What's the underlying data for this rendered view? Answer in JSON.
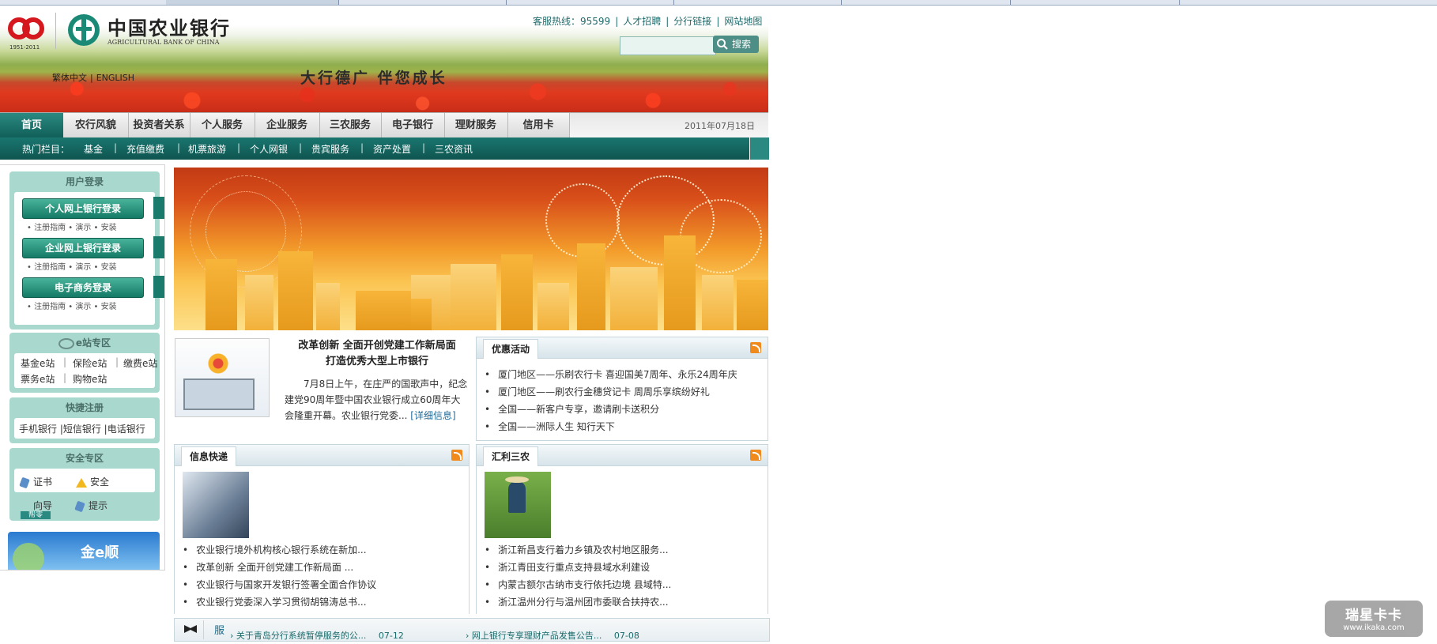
{
  "header": {
    "logo_60_text": "60",
    "logo_60_years": "1951-2011",
    "bank_name_cn": "中国农业银行",
    "bank_name_en": "AGRICULTURAL BANK OF CHINA",
    "slogan": "大行德广  伴您成长",
    "lang_traditional": "繁体中文",
    "lang_english": "ENGLISH",
    "hotline": "客服热线：95599",
    "links": [
      "人才招聘",
      "分行链接",
      "网站地图"
    ],
    "search_placeholder": "",
    "search_label": "搜索"
  },
  "nav": {
    "home": "首页",
    "items": [
      "农行风貌",
      "投资者关系",
      "个人服务",
      "企业服务",
      "三农服务",
      "电子银行",
      "理财服务",
      "信用卡"
    ],
    "date": "2011年07月18日"
  },
  "subnav": {
    "label": "热门栏目：",
    "items": [
      "基金",
      "充值缴费",
      "机票旅游",
      "个人网银",
      "贵宾服务",
      "资产处置",
      "三农资讯"
    ]
  },
  "sidebar": {
    "login_title": "用户登录",
    "personal_login": "个人网上银行登录",
    "corporate_login": "企业网上银行登录",
    "ecommerce_login": "电子商务登录",
    "login_sublinks": "• 注册指南 • 演示 • 安装",
    "estation_title": "e站专区",
    "estation_row1": [
      "基金e站",
      "保险e站",
      "缴费e站"
    ],
    "estation_row2": [
      "票务e站",
      "购物e站"
    ],
    "quick_title": "快捷注册",
    "quick_items": "手机银行 |短信银行 |电话银行",
    "security_title": "安全专区",
    "security_items": [
      "证书",
      "安全",
      "向导",
      "提示"
    ],
    "security_badge": "帮零",
    "promo_text": "金e顺",
    "promo_badge": "金e顺"
  },
  "news": {
    "title_line1": "改革创新  全面开创党建工作新局面",
    "title_line2": "打造优秀大型上市银行",
    "body": "7月8日上午，在庄严的国歌声中，纪念建党90周年暨中国农业银行成立60周年大会隆重开幕。农业银行党委...",
    "more": "[详细信息]"
  },
  "promo_box": {
    "title": "优惠活动",
    "items": [
      "厦门地区——乐刷农行卡  喜迎国美7周年、永乐24周年庆",
      "厦门地区——刷农行金穗贷记卡  周周乐享缤纷好礼",
      "全国——新客户专享，邀请刷卡送积分",
      "全国——洲际人生  知行天下"
    ]
  },
  "info_box": {
    "title": "信息快递",
    "items": [
      "农业银行境外机构核心银行系统在新加...",
      "改革创新  全面开创党建工作新局面  ...",
      "农业银行与国家开发银行签署全面合作协议",
      "农业银行党委深入学习贯彻胡锦涛总书..."
    ]
  },
  "farm_box": {
    "title": "汇利三农",
    "items": [
      "浙江新昌支行着力乡镇及农村地区服务...",
      "浙江青田支行重点支持县域水利建设",
      "内蒙古额尔古纳市支行依托边境  县域特...",
      "浙江温州分行与温州团市委联合扶持农..."
    ]
  },
  "bottom": {
    "label": "服",
    "items": [
      {
        "text": "关于青岛分行系统暂停服务的公...",
        "date": "07-12"
      },
      {
        "text": "网上银行专享理财产品发售公告...",
        "date": "07-08"
      }
    ]
  },
  "watermark": {
    "line1": "瑞星卡卡",
    "line2": "www.ikaka.com"
  }
}
